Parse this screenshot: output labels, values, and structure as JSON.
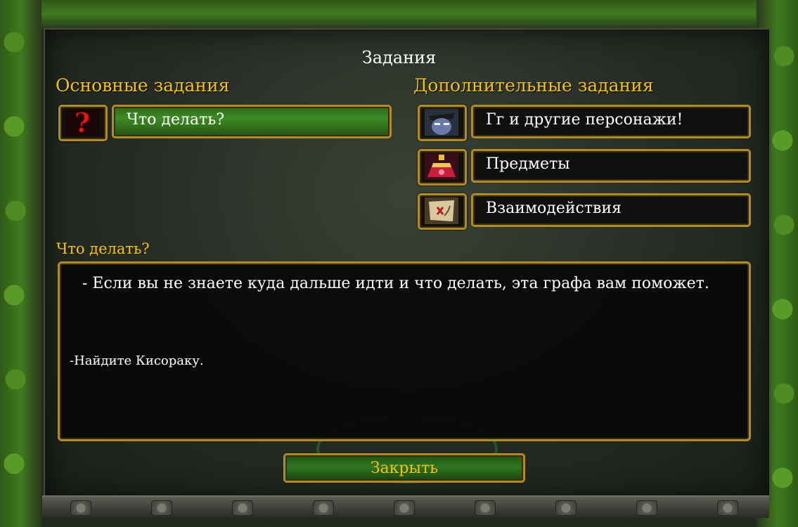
{
  "window": {
    "title": "Задания"
  },
  "main_quests": {
    "heading": "Основные задания",
    "items": [
      {
        "label": "Что делать?",
        "icon": "question-mark-icon",
        "active": true
      }
    ]
  },
  "optional_quests": {
    "heading": "Дополнительные задания",
    "items": [
      {
        "label": "Гг и другие персонажи!",
        "icon": "hero-portrait-icon"
      },
      {
        "label": "Предметы",
        "icon": "potion-icon"
      },
      {
        "label": "Взаимодействия",
        "icon": "scroll-map-icon"
      }
    ]
  },
  "description": {
    "heading": "Что делать?",
    "line1": "- Если вы не знаете куда дальше идти и что делать, эта графа вам поможет.",
    "line2": "-Найдите Кисораку."
  },
  "footer": {
    "close_label": "Закрыть"
  },
  "colors": {
    "accent_gold": "#f2c21a",
    "border_gold": "#b08b2a",
    "active_green": "#3e8a24"
  }
}
